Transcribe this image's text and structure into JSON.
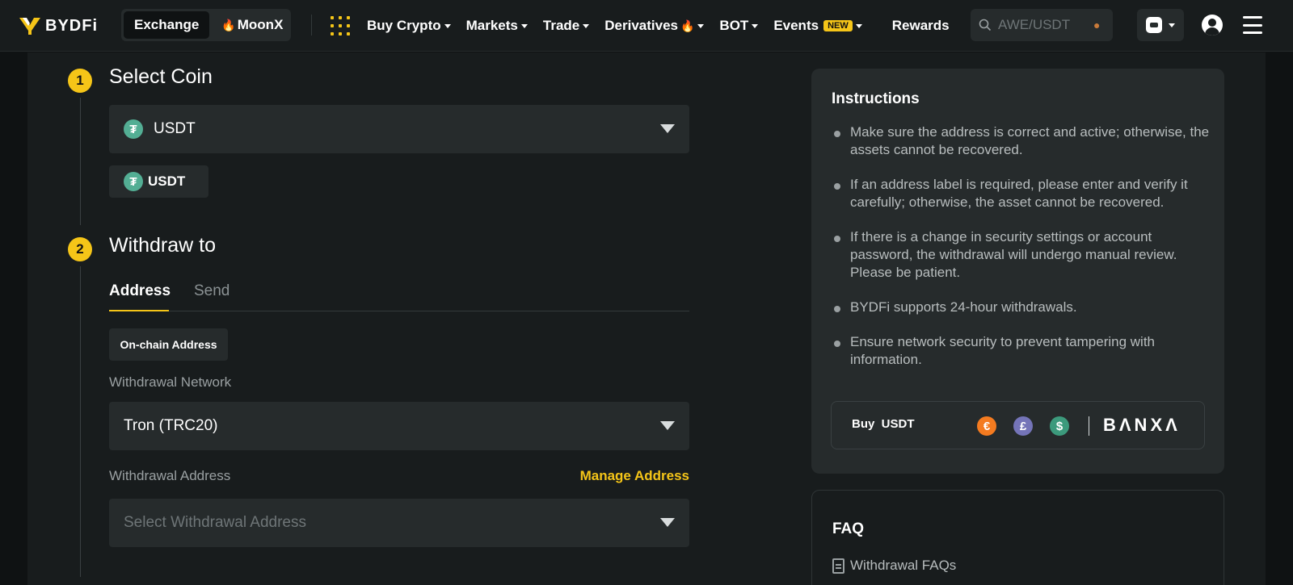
{
  "brand": {
    "name": "BYDFi",
    "accent": "#f5c518"
  },
  "switcher": {
    "exchange": "Exchange",
    "moonx": "MoonX"
  },
  "nav": {
    "items": [
      {
        "label": "Buy Crypto",
        "caret": true
      },
      {
        "label": "Markets",
        "caret": true
      },
      {
        "label": "Trade",
        "caret": true
      },
      {
        "label": "Derivatives",
        "caret": true,
        "icon": "fire-icon"
      },
      {
        "label": "BOT",
        "caret": true
      },
      {
        "label": "Events",
        "caret": true,
        "badge": "NEW"
      },
      {
        "label": "Rewards",
        "caret": false
      }
    ]
  },
  "search": {
    "placeholder": "AWE/USDT"
  },
  "step1": {
    "number": "1",
    "title": "Select Coin",
    "selected_coin": "USDT",
    "coin_icon_glyph": "₮",
    "recent_chip": "USDT"
  },
  "step2": {
    "number": "2",
    "title": "Withdraw to",
    "tabs": [
      "Address",
      "Send"
    ],
    "active_tab": "Address",
    "address_type": "On-chain Address",
    "network_label": "Withdrawal Network",
    "network_value": "Tron (TRC20)",
    "address_label": "Withdrawal Address",
    "manage_address": "Manage Address",
    "address_placeholder": "Select Withdrawal Address"
  },
  "instructions": {
    "title": "Instructions",
    "items": [
      "Make sure the address is correct and active; otherwise, the assets cannot be recovered.",
      "If an address label is required, please enter and verify it carefully; otherwise, the asset cannot be recovered.",
      "If there is a change in security settings or account password, the withdrawal will undergo manual review. Please be patient.",
      "BYDFi supports 24-hour withdrawals.",
      "Ensure network security to prevent tampering with information."
    ],
    "buy": {
      "label": "Buy  USDT",
      "currencies": [
        {
          "symbol": "€",
          "color": "#f47b20"
        },
        {
          "symbol": "£",
          "color": "#7474b8"
        },
        {
          "symbol": "$",
          "color": "#3c9a7c"
        }
      ],
      "provider": "BΛNXΛ"
    }
  },
  "faq": {
    "title": "FAQ",
    "link": "Withdrawal FAQs"
  }
}
